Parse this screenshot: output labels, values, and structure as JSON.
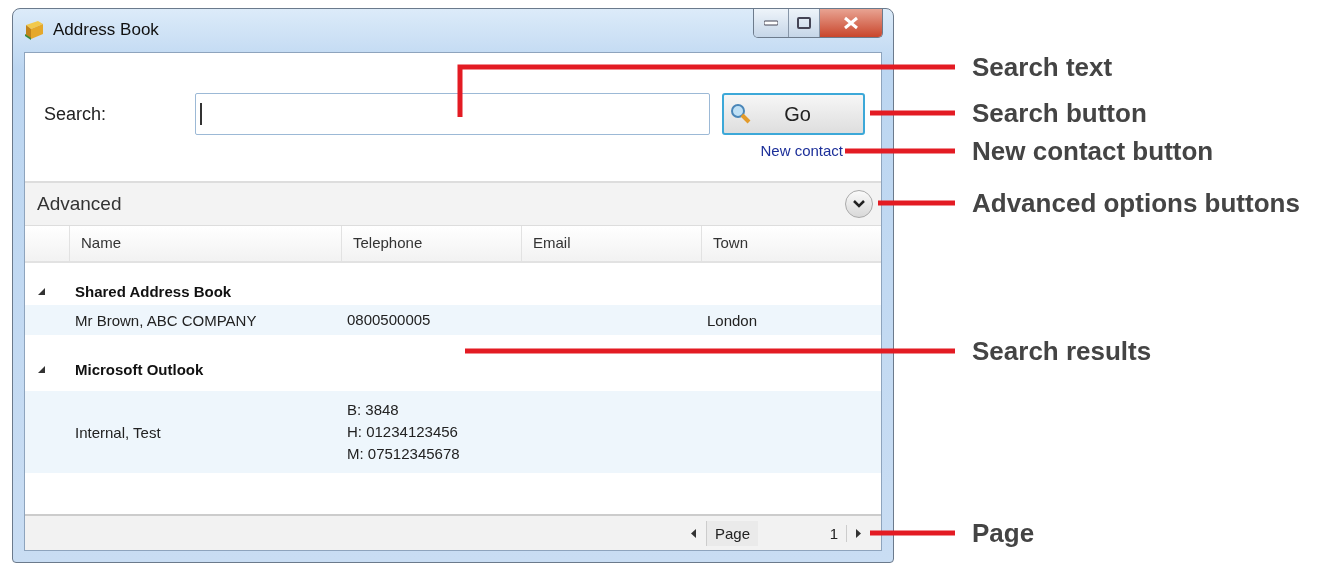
{
  "window": {
    "title": "Address Book"
  },
  "search": {
    "label": "Search:",
    "go_button": "Go",
    "new_contact_link": "New contact"
  },
  "advanced": {
    "label": "Advanced",
    "expanded": false
  },
  "table": {
    "columns": [
      "Name",
      "Telephone",
      "Email",
      "Town"
    ],
    "groups": [
      {
        "name": "Shared Address Book",
        "expanded": true,
        "rows": [
          {
            "name": "Mr Brown, ABC COMPANY",
            "telephone": [
              "0800500005"
            ],
            "town": "London"
          }
        ]
      },
      {
        "name": "Microsoft Outlook",
        "expanded": true,
        "rows": [
          {
            "name": "Internal, Test",
            "telephone": [
              "B: 3848",
              "H: 01234123456",
              "M: 07512345678"
            ]
          }
        ]
      }
    ]
  },
  "pager": {
    "label": "Page",
    "number": "1"
  },
  "annotations": [
    {
      "label": "Search text"
    },
    {
      "label": "Search button"
    },
    {
      "label": "New contact button"
    },
    {
      "label": "Advanced options buttons"
    },
    {
      "label": "Search results"
    },
    {
      "label": "Page"
    }
  ]
}
